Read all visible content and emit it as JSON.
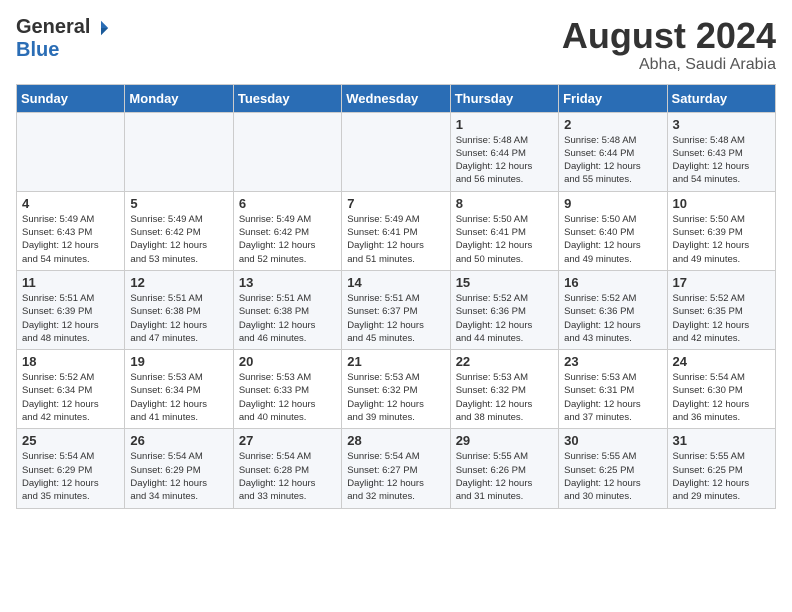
{
  "header": {
    "logo_general": "General",
    "logo_blue": "Blue",
    "main_title": "August 2024",
    "subtitle": "Abha, Saudi Arabia"
  },
  "weekdays": [
    "Sunday",
    "Monday",
    "Tuesday",
    "Wednesday",
    "Thursday",
    "Friday",
    "Saturday"
  ],
  "weeks": [
    [
      {
        "day": "",
        "info": ""
      },
      {
        "day": "",
        "info": ""
      },
      {
        "day": "",
        "info": ""
      },
      {
        "day": "",
        "info": ""
      },
      {
        "day": "1",
        "info": "Sunrise: 5:48 AM\nSunset: 6:44 PM\nDaylight: 12 hours\nand 56 minutes."
      },
      {
        "day": "2",
        "info": "Sunrise: 5:48 AM\nSunset: 6:44 PM\nDaylight: 12 hours\nand 55 minutes."
      },
      {
        "day": "3",
        "info": "Sunrise: 5:48 AM\nSunset: 6:43 PM\nDaylight: 12 hours\nand 54 minutes."
      }
    ],
    [
      {
        "day": "4",
        "info": "Sunrise: 5:49 AM\nSunset: 6:43 PM\nDaylight: 12 hours\nand 54 minutes."
      },
      {
        "day": "5",
        "info": "Sunrise: 5:49 AM\nSunset: 6:42 PM\nDaylight: 12 hours\nand 53 minutes."
      },
      {
        "day": "6",
        "info": "Sunrise: 5:49 AM\nSunset: 6:42 PM\nDaylight: 12 hours\nand 52 minutes."
      },
      {
        "day": "7",
        "info": "Sunrise: 5:49 AM\nSunset: 6:41 PM\nDaylight: 12 hours\nand 51 minutes."
      },
      {
        "day": "8",
        "info": "Sunrise: 5:50 AM\nSunset: 6:41 PM\nDaylight: 12 hours\nand 50 minutes."
      },
      {
        "day": "9",
        "info": "Sunrise: 5:50 AM\nSunset: 6:40 PM\nDaylight: 12 hours\nand 49 minutes."
      },
      {
        "day": "10",
        "info": "Sunrise: 5:50 AM\nSunset: 6:39 PM\nDaylight: 12 hours\nand 49 minutes."
      }
    ],
    [
      {
        "day": "11",
        "info": "Sunrise: 5:51 AM\nSunset: 6:39 PM\nDaylight: 12 hours\nand 48 minutes."
      },
      {
        "day": "12",
        "info": "Sunrise: 5:51 AM\nSunset: 6:38 PM\nDaylight: 12 hours\nand 47 minutes."
      },
      {
        "day": "13",
        "info": "Sunrise: 5:51 AM\nSunset: 6:38 PM\nDaylight: 12 hours\nand 46 minutes."
      },
      {
        "day": "14",
        "info": "Sunrise: 5:51 AM\nSunset: 6:37 PM\nDaylight: 12 hours\nand 45 minutes."
      },
      {
        "day": "15",
        "info": "Sunrise: 5:52 AM\nSunset: 6:36 PM\nDaylight: 12 hours\nand 44 minutes."
      },
      {
        "day": "16",
        "info": "Sunrise: 5:52 AM\nSunset: 6:36 PM\nDaylight: 12 hours\nand 43 minutes."
      },
      {
        "day": "17",
        "info": "Sunrise: 5:52 AM\nSunset: 6:35 PM\nDaylight: 12 hours\nand 42 minutes."
      }
    ],
    [
      {
        "day": "18",
        "info": "Sunrise: 5:52 AM\nSunset: 6:34 PM\nDaylight: 12 hours\nand 42 minutes."
      },
      {
        "day": "19",
        "info": "Sunrise: 5:53 AM\nSunset: 6:34 PM\nDaylight: 12 hours\nand 41 minutes."
      },
      {
        "day": "20",
        "info": "Sunrise: 5:53 AM\nSunset: 6:33 PM\nDaylight: 12 hours\nand 40 minutes."
      },
      {
        "day": "21",
        "info": "Sunrise: 5:53 AM\nSunset: 6:32 PM\nDaylight: 12 hours\nand 39 minutes."
      },
      {
        "day": "22",
        "info": "Sunrise: 5:53 AM\nSunset: 6:32 PM\nDaylight: 12 hours\nand 38 minutes."
      },
      {
        "day": "23",
        "info": "Sunrise: 5:53 AM\nSunset: 6:31 PM\nDaylight: 12 hours\nand 37 minutes."
      },
      {
        "day": "24",
        "info": "Sunrise: 5:54 AM\nSunset: 6:30 PM\nDaylight: 12 hours\nand 36 minutes."
      }
    ],
    [
      {
        "day": "25",
        "info": "Sunrise: 5:54 AM\nSunset: 6:29 PM\nDaylight: 12 hours\nand 35 minutes."
      },
      {
        "day": "26",
        "info": "Sunrise: 5:54 AM\nSunset: 6:29 PM\nDaylight: 12 hours\nand 34 minutes."
      },
      {
        "day": "27",
        "info": "Sunrise: 5:54 AM\nSunset: 6:28 PM\nDaylight: 12 hours\nand 33 minutes."
      },
      {
        "day": "28",
        "info": "Sunrise: 5:54 AM\nSunset: 6:27 PM\nDaylight: 12 hours\nand 32 minutes."
      },
      {
        "day": "29",
        "info": "Sunrise: 5:55 AM\nSunset: 6:26 PM\nDaylight: 12 hours\nand 31 minutes."
      },
      {
        "day": "30",
        "info": "Sunrise: 5:55 AM\nSunset: 6:25 PM\nDaylight: 12 hours\nand 30 minutes."
      },
      {
        "day": "31",
        "info": "Sunrise: 5:55 AM\nSunset: 6:25 PM\nDaylight: 12 hours\nand 29 minutes."
      }
    ]
  ]
}
